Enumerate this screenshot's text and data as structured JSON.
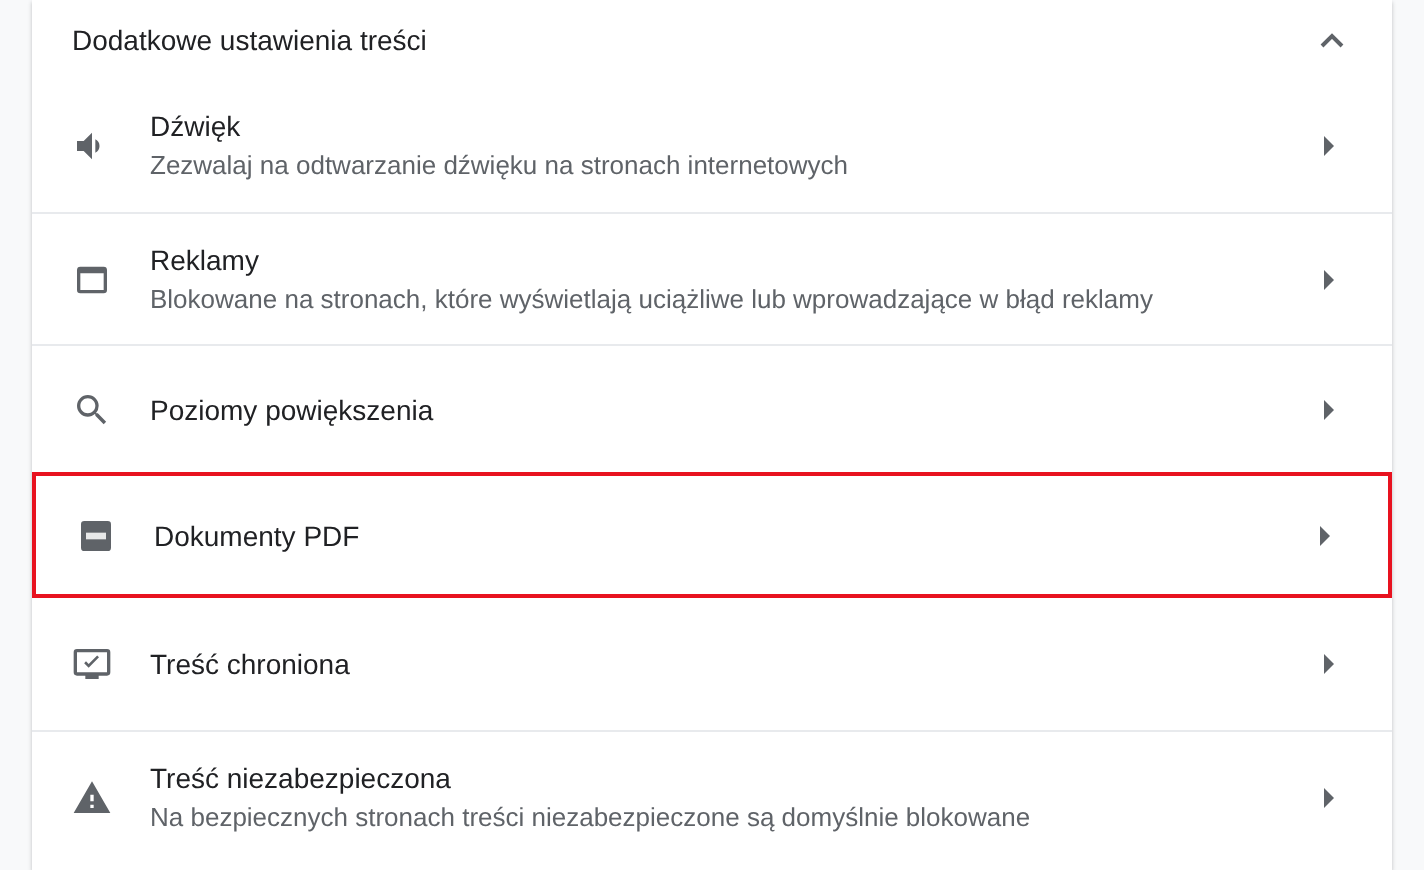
{
  "section": {
    "title": "Dodatkowe ustawienia treści",
    "expanded": true
  },
  "items": [
    {
      "kind": "sound",
      "title": "Dźwięk",
      "subtitle": "Zezwalaj na odtwarzanie dźwięku na stronach internetowych",
      "highlighted": false
    },
    {
      "kind": "ads",
      "title": "Reklamy",
      "subtitle": "Blokowane na stronach, które wyświetlają uciążliwe lub wprowadzające w błąd reklamy",
      "highlighted": false
    },
    {
      "kind": "zoom",
      "title": "Poziomy powiększenia",
      "highlighted": false
    },
    {
      "kind": "pdf",
      "title": "Dokumenty PDF",
      "highlighted": true
    },
    {
      "kind": "protected",
      "title": "Treść chroniona",
      "highlighted": false
    },
    {
      "kind": "insecure",
      "title": "Treść niezabezpieczona",
      "subtitle": "Na bezpiecznych stronach treści niezabezpieczone są domyślnie blokowane",
      "highlighted": false
    }
  ]
}
